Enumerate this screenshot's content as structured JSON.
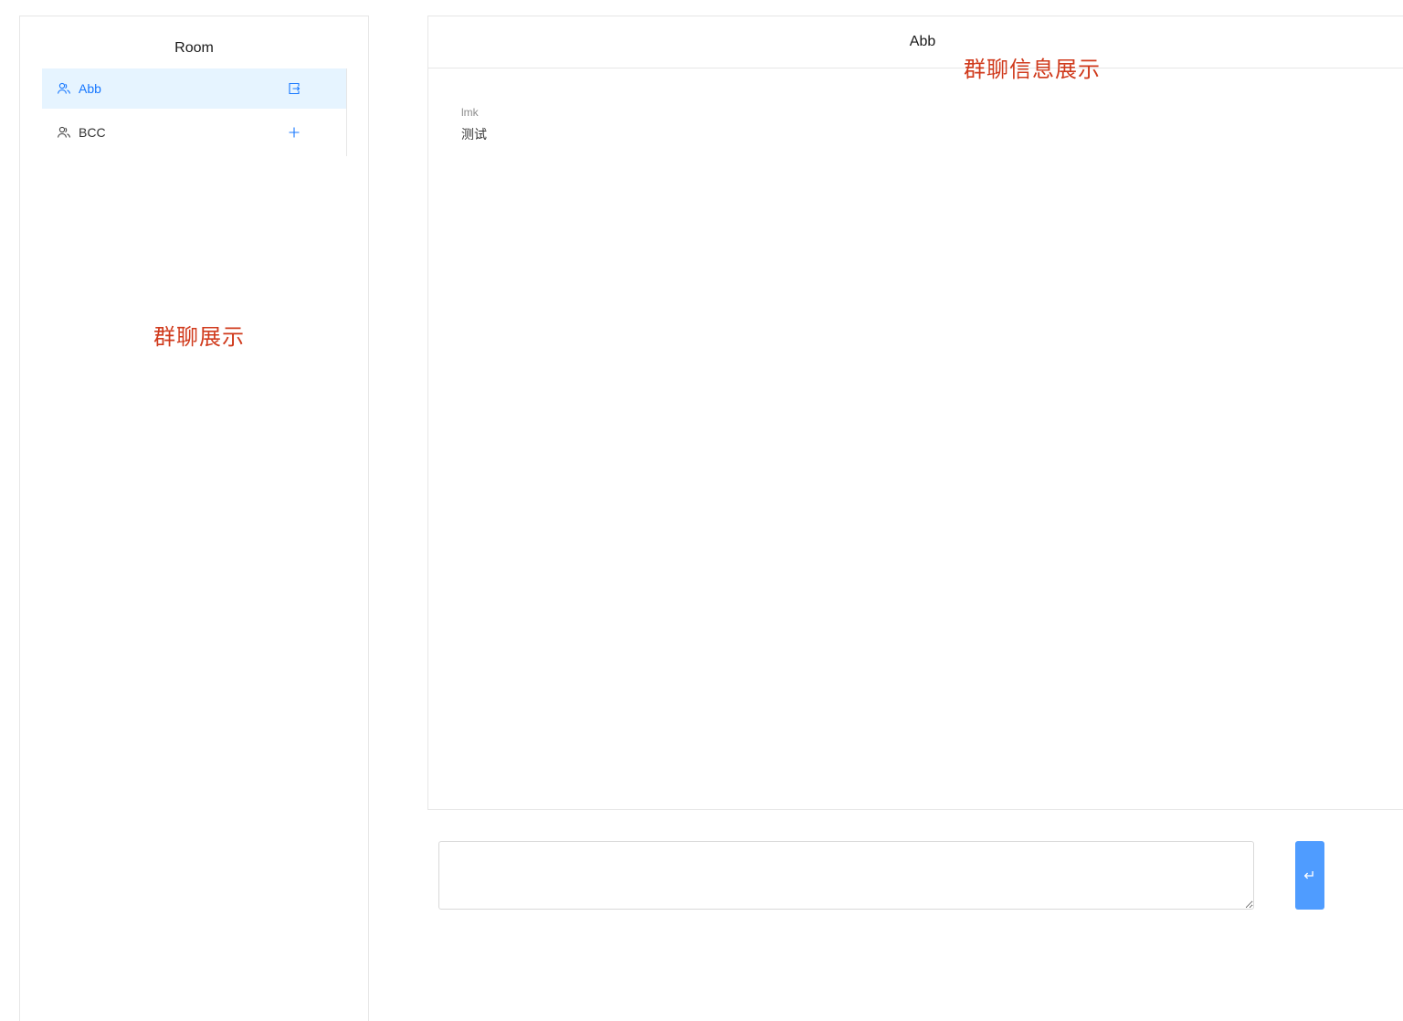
{
  "sidebar": {
    "title": "Room",
    "rooms": [
      {
        "name": "Abb",
        "active": true,
        "action_icon": "exit-icon"
      },
      {
        "name": "BCC",
        "active": false,
        "action_icon": "plus-icon"
      }
    ],
    "annotation": "群聊展示"
  },
  "chat": {
    "title": "Abb",
    "annotation": "群聊信息展示",
    "messages": [
      {
        "sender": "lmk",
        "text": "测试"
      }
    ]
  },
  "input": {
    "value": "",
    "send_icon": "enter-icon",
    "send_glyph": "↵"
  },
  "colors": {
    "accent": "#1677ff",
    "active_bg": "#e6f4ff",
    "annotation": "#d03a1c",
    "send_button": "#4f9cff"
  }
}
